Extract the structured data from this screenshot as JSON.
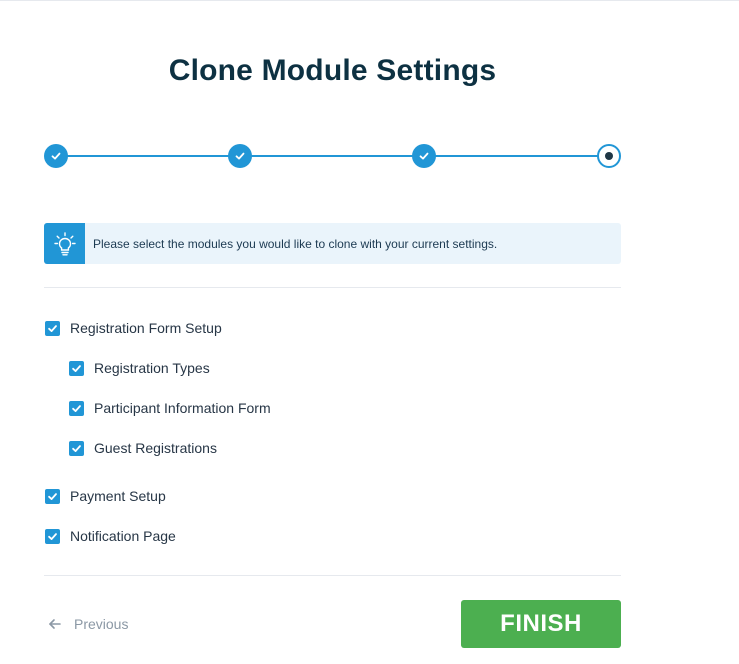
{
  "page": {
    "title": "Clone Module Settings"
  },
  "stepper": {
    "total_steps": 4,
    "current_step": 4,
    "steps": [
      {
        "state": "done",
        "icon": "check-icon"
      },
      {
        "state": "done",
        "icon": "check-icon"
      },
      {
        "state": "done",
        "icon": "check-icon"
      },
      {
        "state": "current",
        "icon": "radio-dot-icon"
      }
    ]
  },
  "info": {
    "icon": "lightbulb-icon",
    "message": "Please select the modules you would like to clone with your current settings."
  },
  "modules": {
    "registration_form_setup": {
      "label": "Registration Form Setup",
      "checked": true
    },
    "registration_types": {
      "label": "Registration Types",
      "checked": true
    },
    "participant_information_form": {
      "label": "Participant Information Form",
      "checked": true
    },
    "guest_registrations": {
      "label": "Guest Registrations",
      "checked": true
    },
    "payment_setup": {
      "label": "Payment Setup",
      "checked": true
    },
    "notification_page": {
      "label": "Notification Page",
      "checked": true
    }
  },
  "footer": {
    "previous_label": "Previous",
    "previous_icon": "arrow-left-icon",
    "finish_label": "FINISH"
  },
  "colors": {
    "accent": "#2196d6",
    "finish": "#4caf50",
    "title": "#0d3142",
    "info_bg": "#eaf4fb"
  }
}
